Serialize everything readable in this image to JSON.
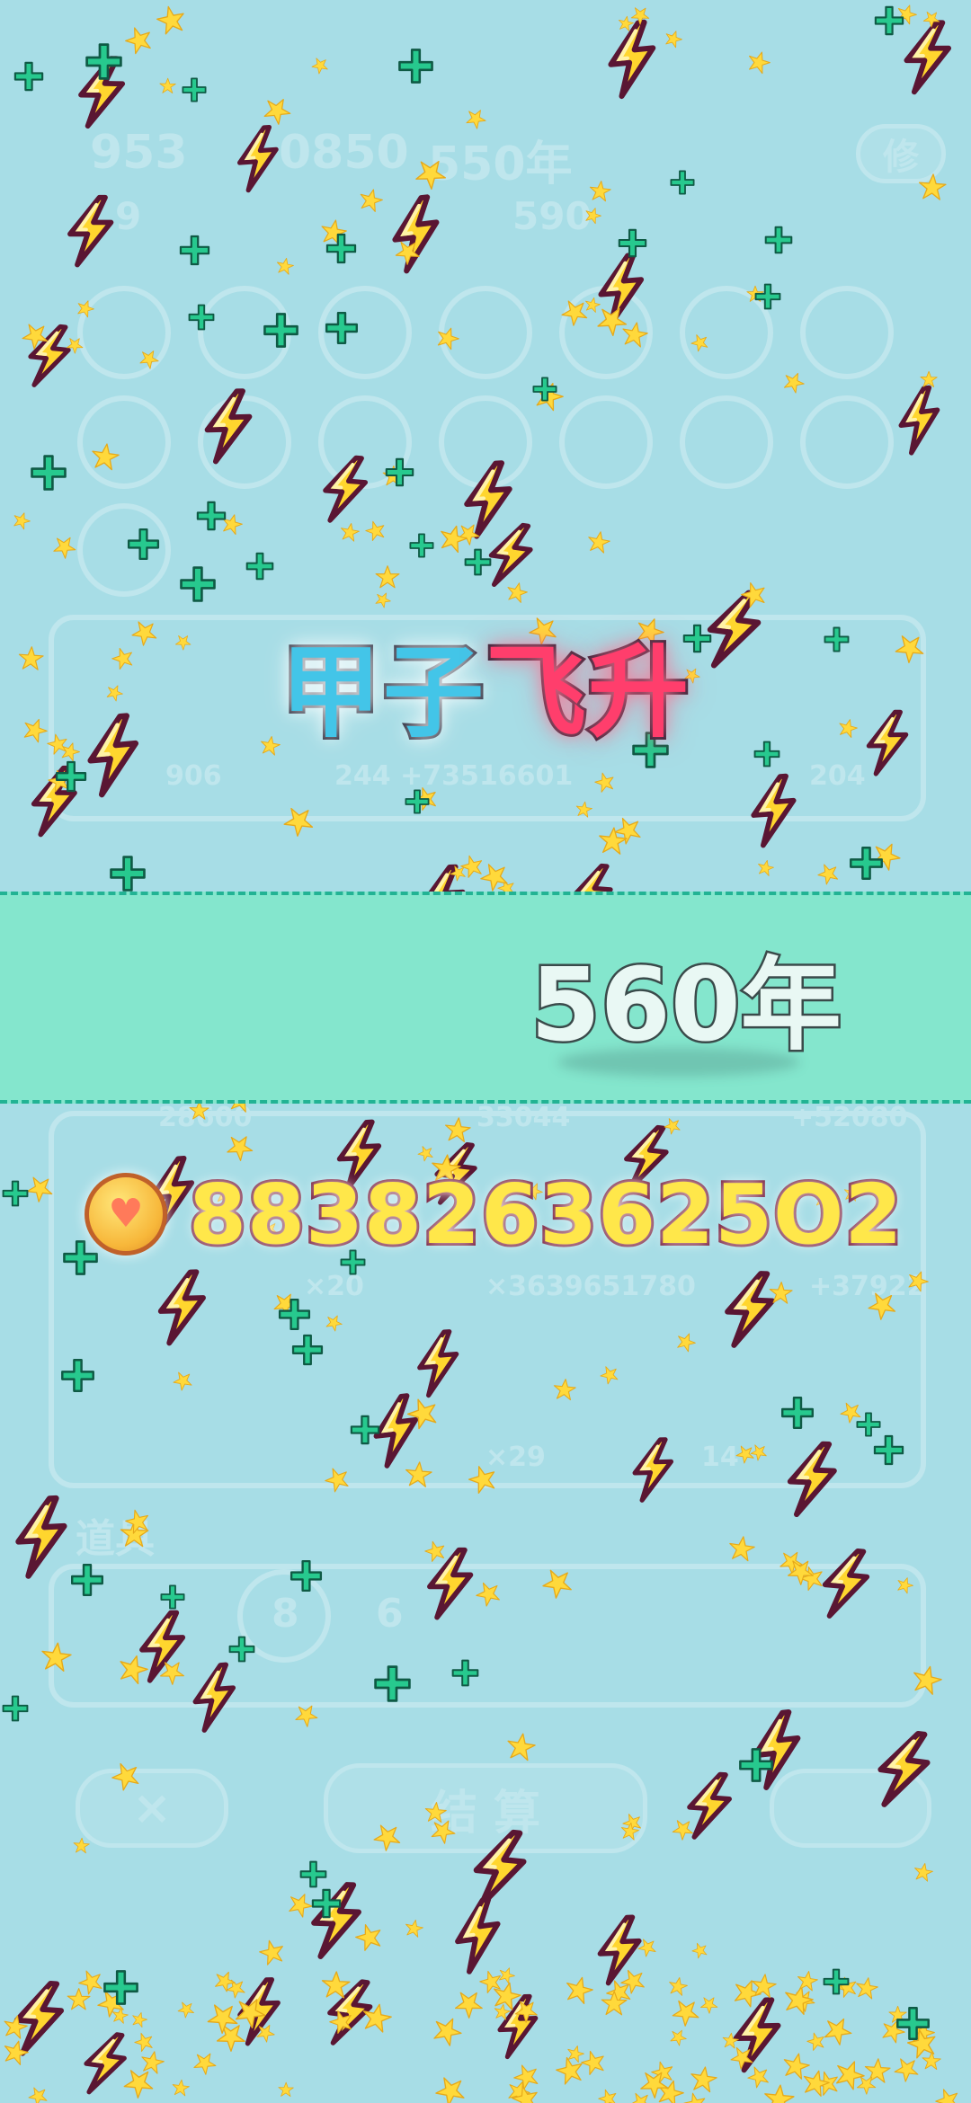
{
  "background_ui": {
    "top_left_score": "953",
    "top_middle_score": "0850",
    "top_years": "550年",
    "sub_count": "9",
    "sub_years": "590",
    "right_button": "修",
    "panel_counts": [
      "906",
      "244 +73516601",
      "204",
      "28600",
      "33044",
      "+52080",
      "×20",
      "×3639651780",
      "+37922",
      "×29",
      "14",
      "8",
      "6"
    ],
    "items_label": "道具",
    "settle_button": "结 算",
    "close_button": "×"
  },
  "effect": {
    "title_part1": "甲子",
    "title_part2": "飞升",
    "years": "560年",
    "coins": "8838263625O2"
  },
  "icons": {
    "coin": "heart-coin-icon",
    "bolt": "lightning-bolt-icon",
    "star": "star-icon",
    "plus": "plus-sparkle-icon"
  },
  "colors": {
    "background": "#a7dde6",
    "banner": "#84e6cd",
    "banner_border": "#22b394",
    "bolt_fill": "#ffd62e",
    "bolt_outline": "#5a1633",
    "star": "#ffd93b",
    "plus": "#27c98e",
    "title_cyan": "#43c5e8",
    "title_pink": "#ff3e6c",
    "coin_text": "#ffe74a"
  }
}
